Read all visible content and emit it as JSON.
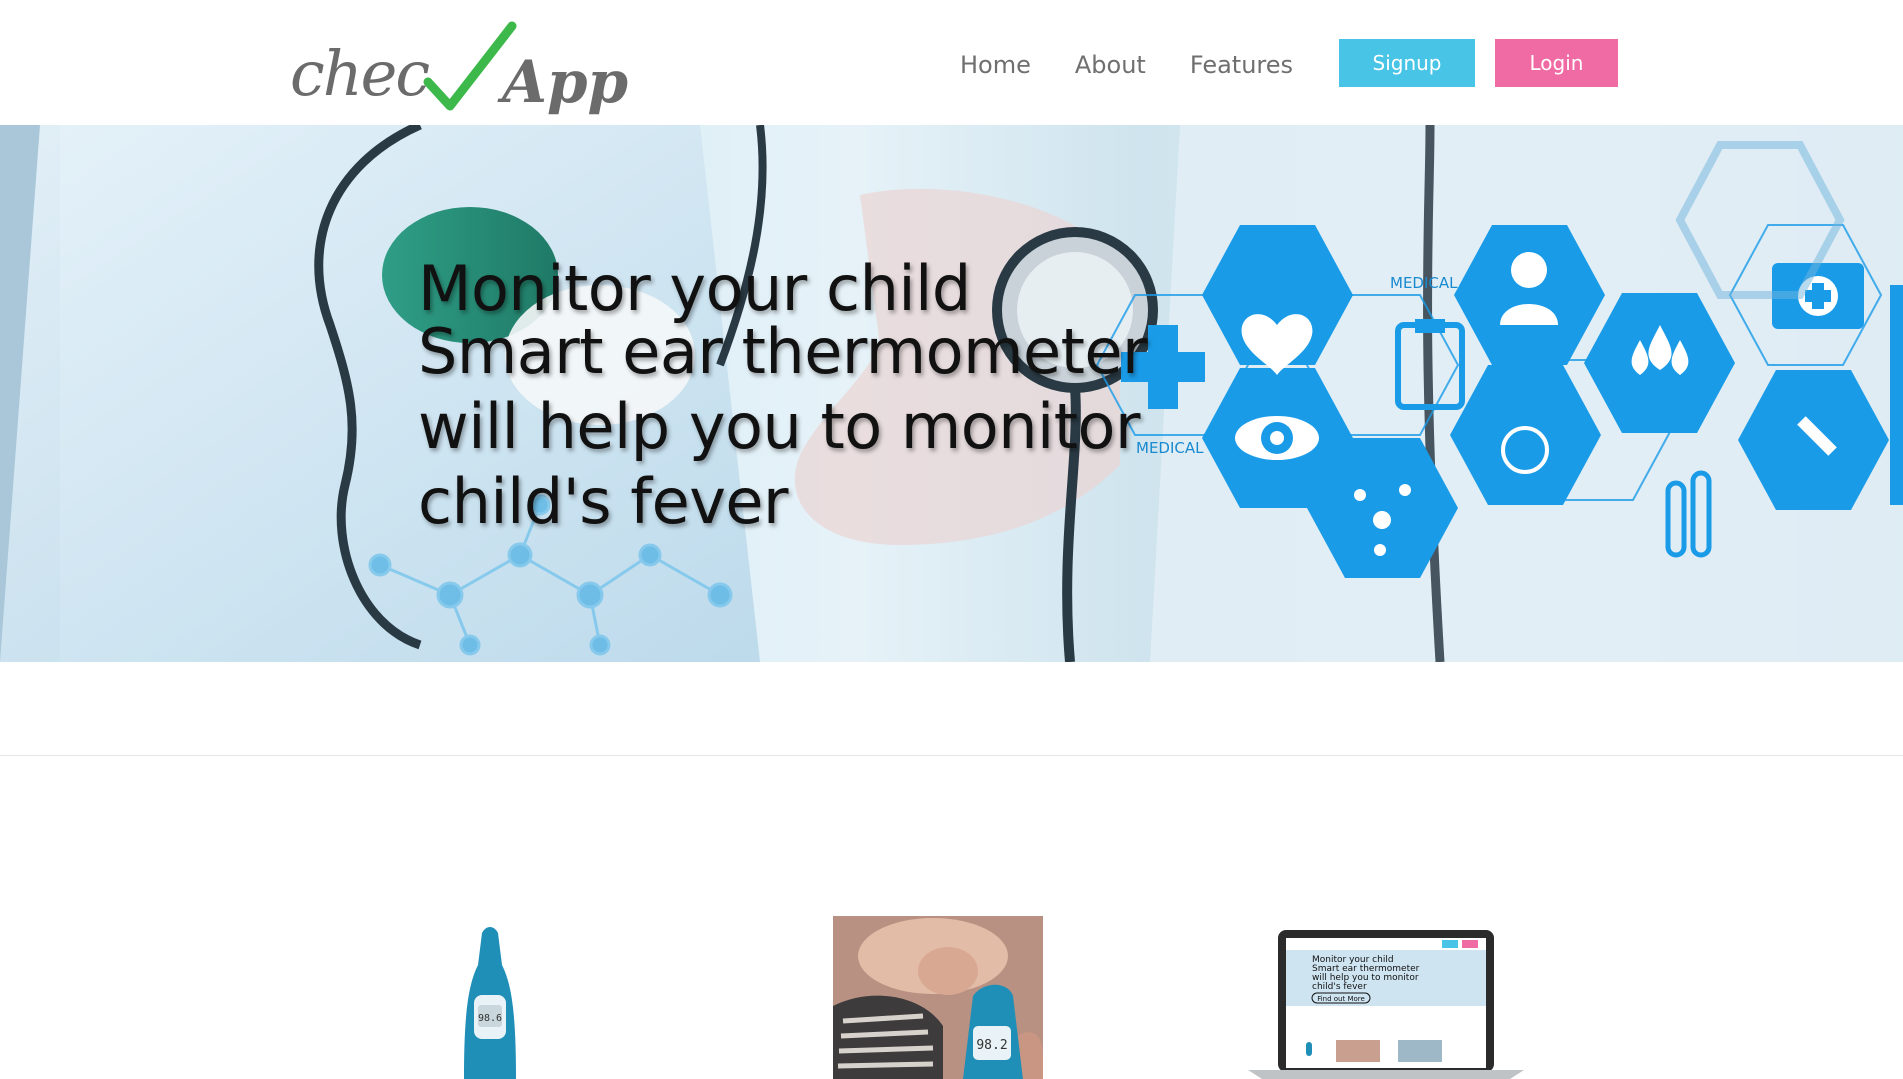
{
  "header": {
    "logo_text": "checkApp",
    "nav": [
      {
        "label": "Home"
      },
      {
        "label": "About"
      },
      {
        "label": "Features"
      }
    ],
    "signup_label": "Signup",
    "login_label": "Login"
  },
  "hero": {
    "lines": [
      "Monitor your child",
      "Smart ear thermometer",
      "will help you to monitor",
      "child's fever"
    ],
    "medical_label_1": "MEDICAL",
    "medical_label_2": "MEDICAL"
  },
  "features": {
    "thermometer_reading": "98.6",
    "baby_thermometer_reading": "98.2",
    "laptop_screen_lines": [
      "Monitor your child",
      "Smart ear thermometer",
      "will help you to monitor",
      "child's fever"
    ],
    "laptop_button": "Find out More"
  },
  "colors": {
    "signup": "#47c4e6",
    "login": "#f06aa4",
    "hex_blue": "#1a9be8",
    "logo_check": "#3cb94a",
    "logo_gray": "#6b6b6b"
  }
}
